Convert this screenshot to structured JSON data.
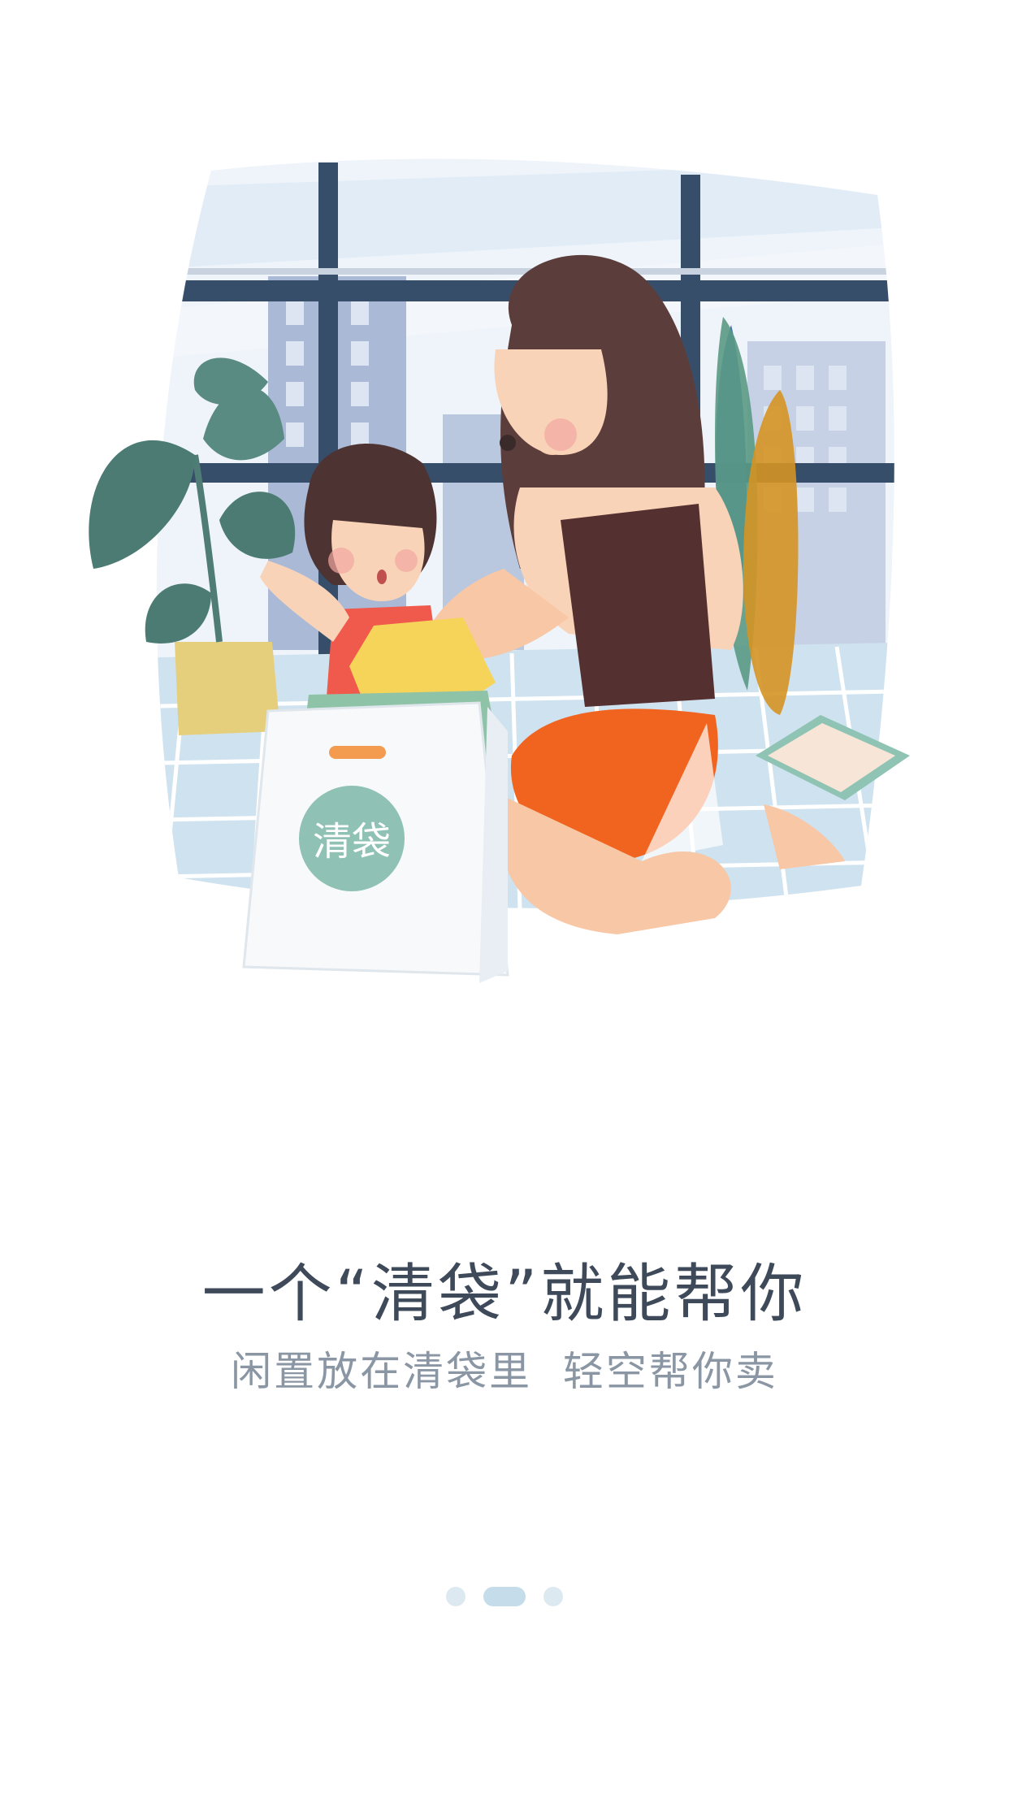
{
  "onboarding": {
    "headline": "一个“清袋”就能帮你",
    "subline": "闲置放在清袋里  轻空帮你卖",
    "bag_logo_text": "清袋",
    "pages": {
      "total": 3,
      "current": 2
    }
  },
  "colors": {
    "headline": "#3e4a5a",
    "subline": "#8a96a3",
    "dot_active": "#c5dcea",
    "dot_inactive": "#dde9f1"
  }
}
